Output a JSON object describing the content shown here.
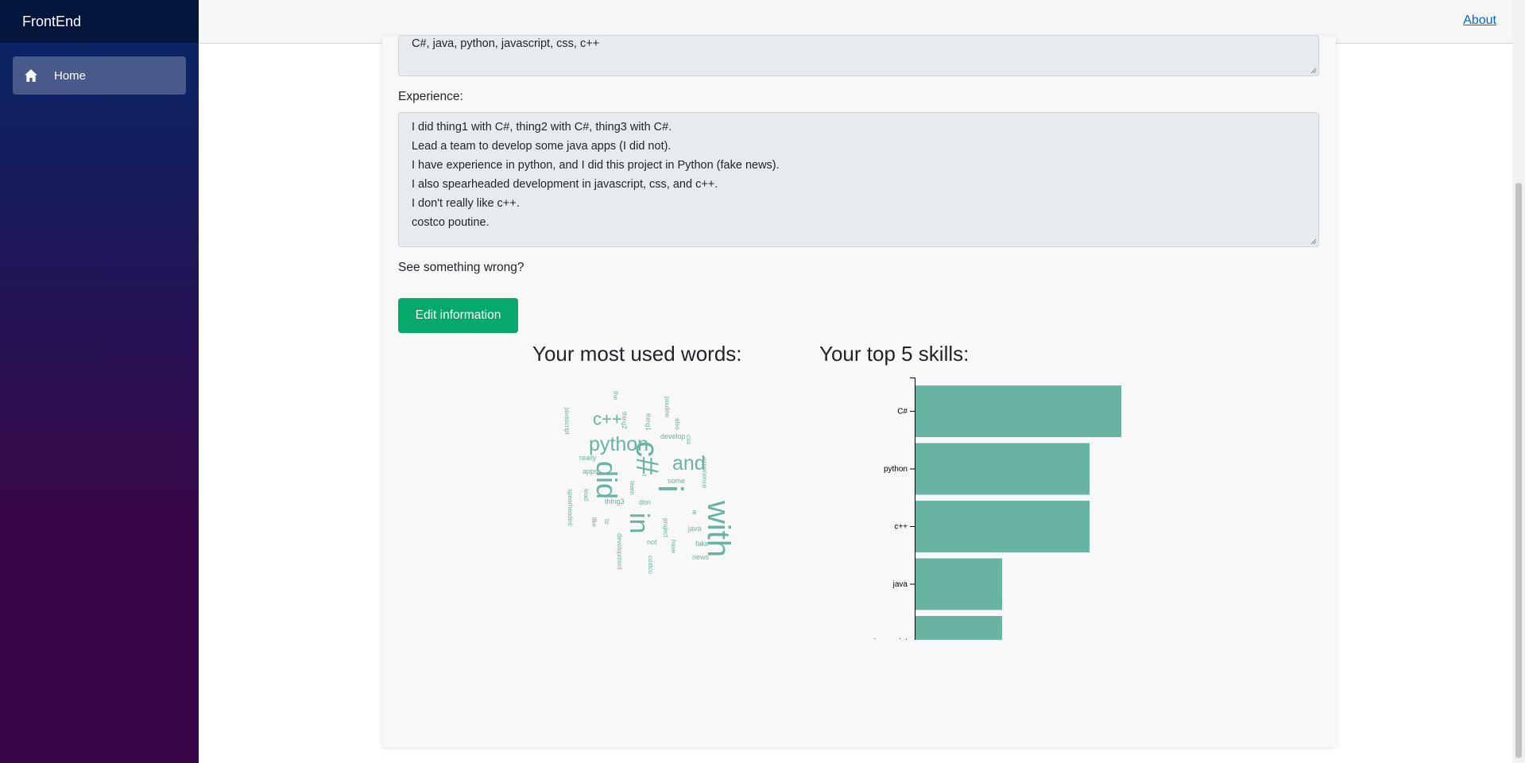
{
  "app": {
    "brand": "FrontEnd"
  },
  "sidebar": {
    "items": [
      {
        "label": "Home",
        "icon": "home-icon"
      }
    ]
  },
  "topbar": {
    "about_link": "About"
  },
  "profile": {
    "skills_text": "C#, java, python, javascript, css, c++",
    "experience_label": "Experience:",
    "experience_lines": [
      "I did thing1 with C#, thing2 with C#, thing3 with C#.",
      "Lead a team to develop some java apps (I did not).",
      "I have experience in python, and I did this project in Python (fake news).",
      "I also spearheaded development in javascript, css, and c++.",
      "I don't really like c++.",
      "costco poutine."
    ],
    "wrong_prompt": "See something wrong?",
    "edit_button": "Edit information"
  },
  "wordcloud": {
    "title": "Your most used words:",
    "color": "#69b3a2",
    "words": [
      {
        "text": "i",
        "size": 44,
        "rotate": 90
      },
      {
        "text": "with",
        "size": 40,
        "rotate": 90
      },
      {
        "text": "c#",
        "size": 40,
        "rotate": 90
      },
      {
        "text": "did",
        "size": 36,
        "rotate": 90
      },
      {
        "text": "in",
        "size": 34,
        "rotate": 90
      },
      {
        "text": "python",
        "size": 25,
        "rotate": 0
      },
      {
        "text": "and",
        "size": 25,
        "rotate": 0
      },
      {
        "text": "c++",
        "size": 22,
        "rotate": 0
      },
      {
        "text": "javascript",
        "size": 8,
        "rotate": 90
      },
      {
        "text": "the",
        "size": 8,
        "rotate": 90
      },
      {
        "text": "thing2",
        "size": 8,
        "rotate": 90
      },
      {
        "text": "thing1",
        "size": 8,
        "rotate": 90
      },
      {
        "text": "poutine",
        "size": 8,
        "rotate": 90
      },
      {
        "text": "also",
        "size": 8,
        "rotate": 90
      },
      {
        "text": "develop",
        "size": 9,
        "rotate": 0
      },
      {
        "text": "css",
        "size": 8,
        "rotate": 90
      },
      {
        "text": "experience",
        "size": 8,
        "rotate": 90
      },
      {
        "text": "really",
        "size": 9,
        "rotate": 0
      },
      {
        "text": "apps",
        "size": 9,
        "rotate": 0
      },
      {
        "text": "spearheaded",
        "size": 8,
        "rotate": 90
      },
      {
        "text": "lead",
        "size": 8,
        "rotate": 90
      },
      {
        "text": "thing3",
        "size": 9,
        "rotate": 0
      },
      {
        "text": "t",
        "size": 8,
        "rotate": 90
      },
      {
        "text": "team",
        "size": 8,
        "rotate": 90
      },
      {
        "text": "some",
        "size": 9,
        "rotate": 0
      },
      {
        "text": "don",
        "size": 9,
        "rotate": 0
      },
      {
        "text": "a",
        "size": 9,
        "rotate": 0
      },
      {
        "text": "like",
        "size": 8,
        "rotate": 90
      },
      {
        "text": "to",
        "size": 8,
        "rotate": 90
      },
      {
        "text": "development",
        "size": 8,
        "rotate": 90
      },
      {
        "text": "project",
        "size": 8,
        "rotate": 90
      },
      {
        "text": "java",
        "size": 9,
        "rotate": 0
      },
      {
        "text": "not",
        "size": 9,
        "rotate": 0
      },
      {
        "text": "have",
        "size": 8,
        "rotate": 90
      },
      {
        "text": "fake",
        "size": 9,
        "rotate": 0
      },
      {
        "text": "costco",
        "size": 8,
        "rotate": 90
      },
      {
        "text": "news",
        "size": 9,
        "rotate": 0
      }
    ]
  },
  "chart_data": {
    "type": "bar",
    "orientation": "horizontal",
    "title": "Your top 5 skills:",
    "categories": [
      "C#",
      "python",
      "c++",
      "java",
      "javascript"
    ],
    "values": [
      3,
      2,
      2,
      1,
      1
    ],
    "xlim": [
      0,
      3
    ],
    "xticks": [
      "0",
      "1",
      "2",
      "3"
    ],
    "color": "#69b3a2"
  },
  "colors": {
    "accent": "#06a86b",
    "link": "#0366d6"
  }
}
